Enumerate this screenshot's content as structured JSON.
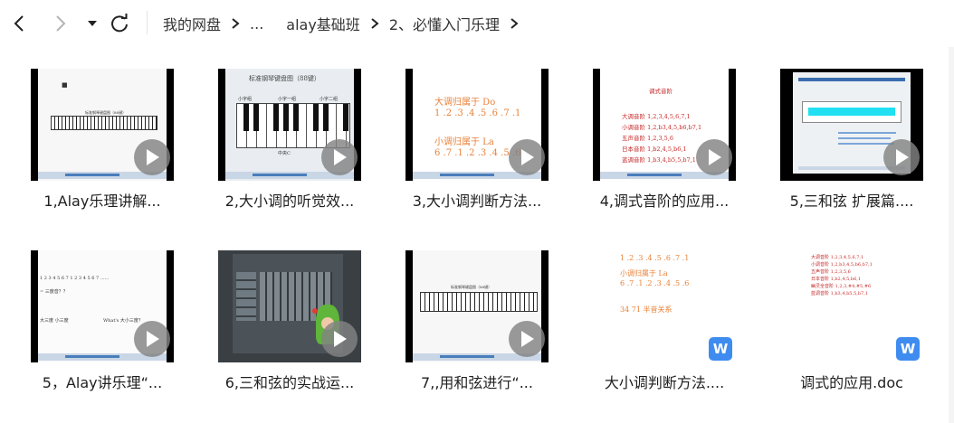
{
  "nav": {
    "breadcrumbs": [
      "我的网盘",
      "...",
      "alay基础班",
      "2、必懂入门乐理"
    ]
  },
  "files": [
    {
      "name": "1,Alay乐理讲解...",
      "type": "video",
      "thumb": "keyboard-small",
      "thumb_text": [
        "标准钢琴键盘图（88键）"
      ]
    },
    {
      "name": "2,大小调的听觉效...",
      "type": "video",
      "thumb": "keyboard-large",
      "thumb_text": [
        "标准钢琴键盘图（88键）",
        "小字组",
        "小字一组",
        "小字二组",
        "中央C"
      ]
    },
    {
      "name": "3,大小调判断方法...",
      "type": "video",
      "thumb": "scale-text",
      "thumb_text": [
        "大调归属于 Do",
        "1 .2 .3 .4 .5 .6 .7 .1",
        "小调归属于 La",
        "6 .7 .1 .2 .3 .4 .5 .6"
      ]
    },
    {
      "name": "4,调式音阶的应用...",
      "type": "video",
      "thumb": "mode-list",
      "thumb_text": [
        "调式音阶",
        "大调音阶 1,2,3,4,5,6,7,1",
        "小调音阶 1,2,b3,4,5,b6,b7,1",
        "五声音阶 1,2,3,5,6",
        "日本音阶 1,b2,4,5,b6,1",
        "蓝调音阶 1,b3,4,b5,5,b7,1"
      ]
    },
    {
      "name": "5,三和弦 扩展篇....",
      "type": "video",
      "thumb": "window-cyan",
      "thumb_text": []
    },
    {
      "name": "5，Alay讲乐理“...",
      "type": "video",
      "thumb": "numbers-text",
      "thumb_text": [
        "1 2 3 4 5 6 7    1 2 3 4 5 6 7 ......",
        "= 三度音？？",
        "大三度 小三度",
        "What's 大小三度？"
      ]
    },
    {
      "name": "6,三和弦的实战运...",
      "type": "video",
      "thumb": "daw",
      "thumb_text": []
    },
    {
      "name": "7,,用和弦进行“...",
      "type": "video",
      "thumb": "keyboard-small",
      "thumb_text": [
        "标准钢琴键盘图（88键）"
      ]
    },
    {
      "name": "大小调判断方法....",
      "type": "doc",
      "thumb": "doc-scales",
      "thumb_text": [
        "1 .2 .3 .4 .5 .6 .7 .1",
        "小调归属于 La",
        "6 .7 .1 .2 .3 .4 .5 .6",
        "34  71  半音关系"
      ]
    },
    {
      "name": "调式的应用.doc",
      "type": "doc",
      "thumb": "doc-modes",
      "thumb_text": [
        "大调音阶 1,2,3,4,5,6,7,1",
        "小调音阶 1,2,b3,4,5,b6,b7,1",
        "五声音阶 1,2,3,5,6",
        "日本音阶 1,b2,4,5,b6,1",
        "幽灵全音阶 1,2,3,#4,#5,#6",
        "蓝调音阶 1,b3,4,b5,5,b7,1"
      ]
    }
  ],
  "colors": {
    "accent_blue": "#3f8cf0",
    "play_overlay": "#828282",
    "orange_text": "#e8823a",
    "red_text": "#c62828"
  }
}
